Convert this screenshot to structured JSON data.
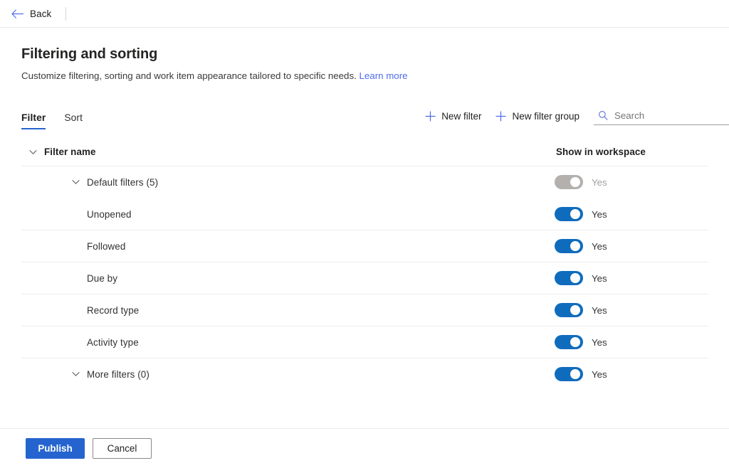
{
  "topbar": {
    "back_label": "Back",
    "back_icon": "arrow-left-icon"
  },
  "header": {
    "title": "Filtering and sorting",
    "subtitle": "Customize filtering, sorting and work item appearance tailored to specific needs.",
    "learn_more": "Learn more"
  },
  "tabs": [
    {
      "label": "Filter",
      "active": true
    },
    {
      "label": "Sort",
      "active": false
    }
  ],
  "commands": {
    "new_filter": "New filter",
    "new_filter_group": "New filter group",
    "plus_icon": "plus-icon"
  },
  "search": {
    "placeholder": "Search",
    "value": "",
    "icon": "search-icon"
  },
  "grid": {
    "columns": {
      "name": "Filter name",
      "toggle": "Show in workspace"
    },
    "rows": [
      {
        "name": "Default filters (5)",
        "indent": 1,
        "chevron": true,
        "toggle_on": true,
        "toggle_disabled": true,
        "toggle_label": "Yes",
        "divider": false
      },
      {
        "name": "Unopened",
        "indent": 2,
        "chevron": false,
        "toggle_on": true,
        "toggle_disabled": false,
        "toggle_label": "Yes",
        "divider": true
      },
      {
        "name": "Followed",
        "indent": 2,
        "chevron": false,
        "toggle_on": true,
        "toggle_disabled": false,
        "toggle_label": "Yes",
        "divider": true
      },
      {
        "name": "Due by",
        "indent": 2,
        "chevron": false,
        "toggle_on": true,
        "toggle_disabled": false,
        "toggle_label": "Yes",
        "divider": true
      },
      {
        "name": "Record type",
        "indent": 2,
        "chevron": false,
        "toggle_on": true,
        "toggle_disabled": false,
        "toggle_label": "Yes",
        "divider": true
      },
      {
        "name": "Activity type",
        "indent": 2,
        "chevron": false,
        "toggle_on": true,
        "toggle_disabled": false,
        "toggle_label": "Yes",
        "divider": true
      },
      {
        "name": "More filters (0)",
        "indent": 1,
        "chevron": true,
        "toggle_on": true,
        "toggle_disabled": false,
        "toggle_label": "Yes",
        "divider": false
      }
    ]
  },
  "footer": {
    "publish": "Publish",
    "cancel": "Cancel"
  },
  "colors": {
    "accent": "#2564cf",
    "toggle_on": "#0f6cbd",
    "toggle_disabled": "#b3b0ad",
    "link": "#4f6bed"
  }
}
